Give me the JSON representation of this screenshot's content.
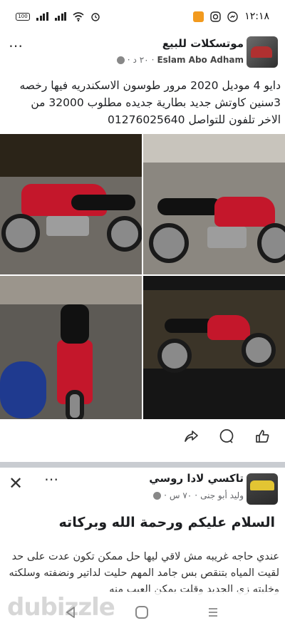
{
  "status": {
    "time": "١٢:١٨",
    "battery": "100"
  },
  "post1": {
    "group_name": "موتسكلات للبيع",
    "author": "Eslam Abo Adham",
    "age": "٢٠ د",
    "text": "دايو 4 موديل 2020 مرور طوسون الاسكندريه فيها رخصه 3سنين كاوتش جديد بطارية جديده مطلوب 32000 من الاخر تلفون للتواصل 01276025640",
    "photos": [
      {
        "alt": "motorcycle-photo-1"
      },
      {
        "alt": "motorcycle-photo-2"
      },
      {
        "alt": "motorcycle-photo-3"
      },
      {
        "alt": "motorcycle-photo-4"
      }
    ],
    "more_icon": "⋯"
  },
  "post2": {
    "group_name": "تاكسي لادا روسي",
    "author": "وليد أبو جنى",
    "age": "٧٠ س",
    "greeting": "السلام عليكم ورحمة الله وبركاته",
    "body": "عندي حاجه غريبه مش لاقي ليها حل ممكن تكون عدت على حد لقيت المياه بتنقص بس جامد المهم حليت لداتير ونضفته وسلكته وخليته زي الجديد وقلت يمكن العيب منه",
    "close_icon": "✕",
    "more_icon": "⋯"
  },
  "footer": {
    "brand": "dubizzle"
  },
  "colors": {
    "bike_red": "#c4172b",
    "divider": "#c9ccd1",
    "meta_text": "#65676b"
  },
  "icons": [
    "share-icon",
    "comment-icon",
    "like-icon",
    "globe-icon",
    "wifi-icon",
    "signal-icon",
    "battery-icon"
  ]
}
